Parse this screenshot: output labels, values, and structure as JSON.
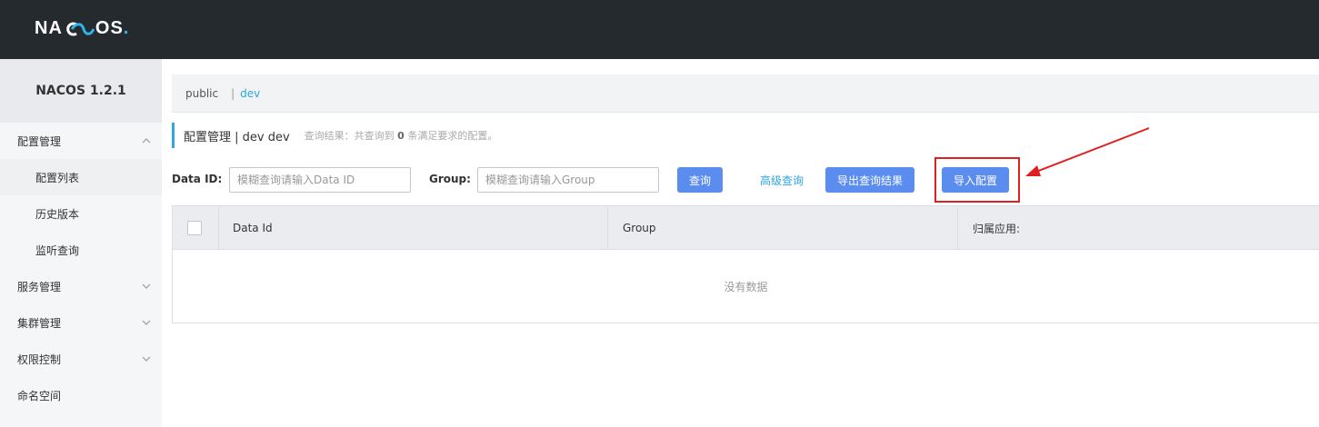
{
  "header": {
    "logo_text_a": "NA",
    "logo_text_b": "OS",
    "logo_dot": "."
  },
  "sidebar": {
    "title": "NACOS 1.2.1",
    "groups": [
      {
        "label": "配置管理",
        "expanded": true,
        "items": [
          "配置列表",
          "历史版本",
          "监听查询"
        ]
      },
      {
        "label": "服务管理",
        "expanded": false
      },
      {
        "label": "集群管理",
        "expanded": false
      },
      {
        "label": "权限控制",
        "expanded": false
      },
      {
        "label": "命名空间"
      }
    ]
  },
  "breadcrumb": {
    "namespace": "public",
    "separator": "|",
    "current": "dev"
  },
  "page": {
    "title": "配置管理 | dev dev",
    "hint_prefix": "查询结果：共查询到",
    "count": "0",
    "hint_suffix": "条满足要求的配置。"
  },
  "filters": {
    "data_id_label": "Data ID:",
    "data_id_placeholder": "模糊查询请输入Data ID",
    "group_label": "Group:",
    "group_placeholder": "模糊查询请输入Group",
    "search_button": "查询",
    "advanced_link": "高级查询",
    "export_button": "导出查询结果",
    "import_button": "导入配置"
  },
  "table": {
    "columns": [
      "Data Id",
      "Group",
      "归属应用:"
    ],
    "empty_text": "没有数据"
  },
  "colors": {
    "accent": "#5b8def",
    "link": "#2fa5e1",
    "header_bg": "#252a2f",
    "highlight": "#e02020"
  }
}
